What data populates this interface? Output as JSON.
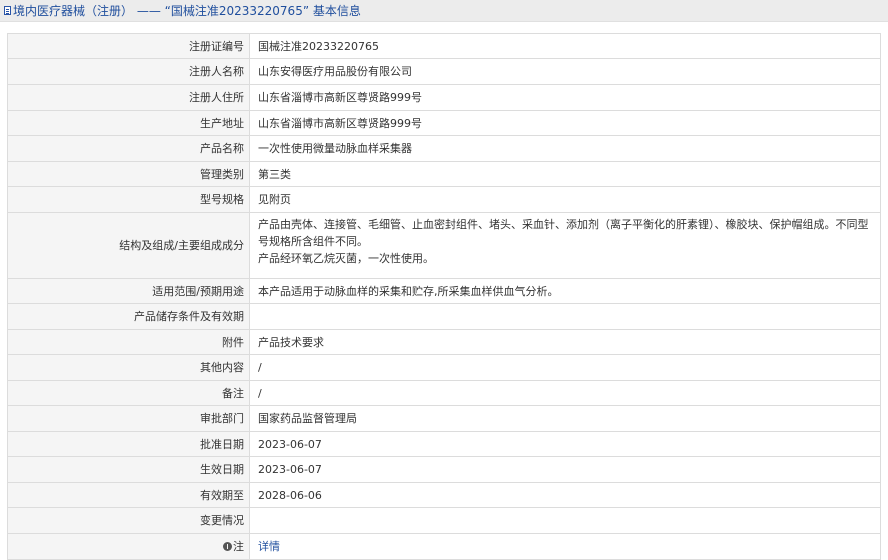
{
  "header": {
    "title": "境内医疗器械（注册） —— “国械注准20233220765” 基本信息"
  },
  "rows": [
    {
      "label": "注册证编号",
      "value": "国械注准20233220765"
    },
    {
      "label": "注册人名称",
      "value": "山东安得医疗用品股份有限公司"
    },
    {
      "label": "注册人住所",
      "value": "山东省淄博市高新区尊贤路999号"
    },
    {
      "label": "生产地址",
      "value": "山东省淄博市高新区尊贤路999号"
    },
    {
      "label": "产品名称",
      "value": "一次性使用微量动脉血样采集器"
    },
    {
      "label": "管理类别",
      "value": "第三类"
    },
    {
      "label": "型号规格",
      "value": "见附页"
    },
    {
      "label": "结构及组成/主要组成成分",
      "value_line1": "产品由壳体、连接管、毛细管、止血密封组件、堵头、采血针、添加剂（离子平衡化的肝素锂）、橡胶块、保护帽组成。不同型号规格所含组件不同。",
      "value_line2": "产品经环氧乙烷灭菌，一次性使用。"
    },
    {
      "label": "适用范围/预期用途",
      "value": "本产品适用于动脉血样的采集和贮存,所采集血样供血气分析。"
    },
    {
      "label": "产品储存条件及有效期",
      "value": ""
    },
    {
      "label": "附件",
      "value": "产品技术要求"
    },
    {
      "label": "其他内容",
      "value": "/"
    },
    {
      "label": "备注",
      "value": "/"
    },
    {
      "label": "审批部门",
      "value": "国家药品监督管理局"
    },
    {
      "label": "批准日期",
      "value": "2023-06-07"
    },
    {
      "label": "生效日期",
      "value": "2023-06-07"
    },
    {
      "label": "有效期至",
      "value": "2028-06-06"
    },
    {
      "label": "变更情况",
      "value": ""
    },
    {
      "label": "注",
      "value": "详情",
      "icon": "info-circle-icon"
    }
  ]
}
